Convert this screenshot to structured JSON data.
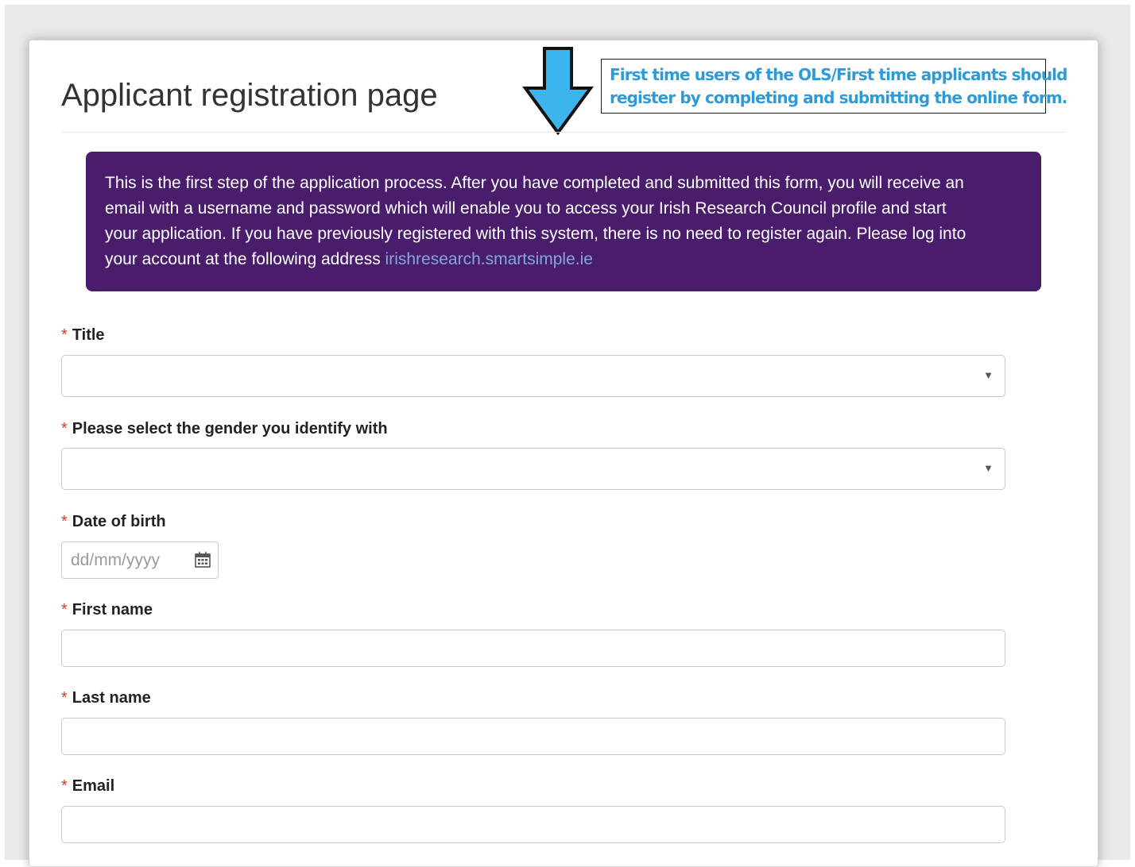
{
  "page": {
    "title": "Applicant registration page"
  },
  "callout": {
    "line1": "First time users of the OLS/First time applicants should",
    "line2": "register by completing and submitting the online form.",
    "arrow_icon": "down-arrow-icon",
    "color": "#2f9bd6",
    "arrow_color": "#3db4ec"
  },
  "info": {
    "line1": "This is the first step of the application process. After you have completed and submitted this form, you will receive an",
    "line2": "email with a username and password which will enable you to access your Irish Research Council profile and start",
    "line3": "your application. If you have previously registered with this system, there is no need to register again. Please log into",
    "line4_prefix": "your account at the following address ",
    "link_text": "irishresearch.smartsimple.ie",
    "background": "#4a1d6c",
    "link_color": "#7fa9dd"
  },
  "form": {
    "required_marker": "*",
    "title_label": "Title",
    "title_value": "",
    "gender_label": "Please select the gender you identify with",
    "gender_value": "",
    "dob_label": "Date of birth",
    "dob_placeholder": "dd/mm/yyyy",
    "first_name_label": "First name",
    "last_name_label": "Last name",
    "email_label": "Email",
    "select_caret": "▼",
    "required_color": "#d33a2c"
  }
}
